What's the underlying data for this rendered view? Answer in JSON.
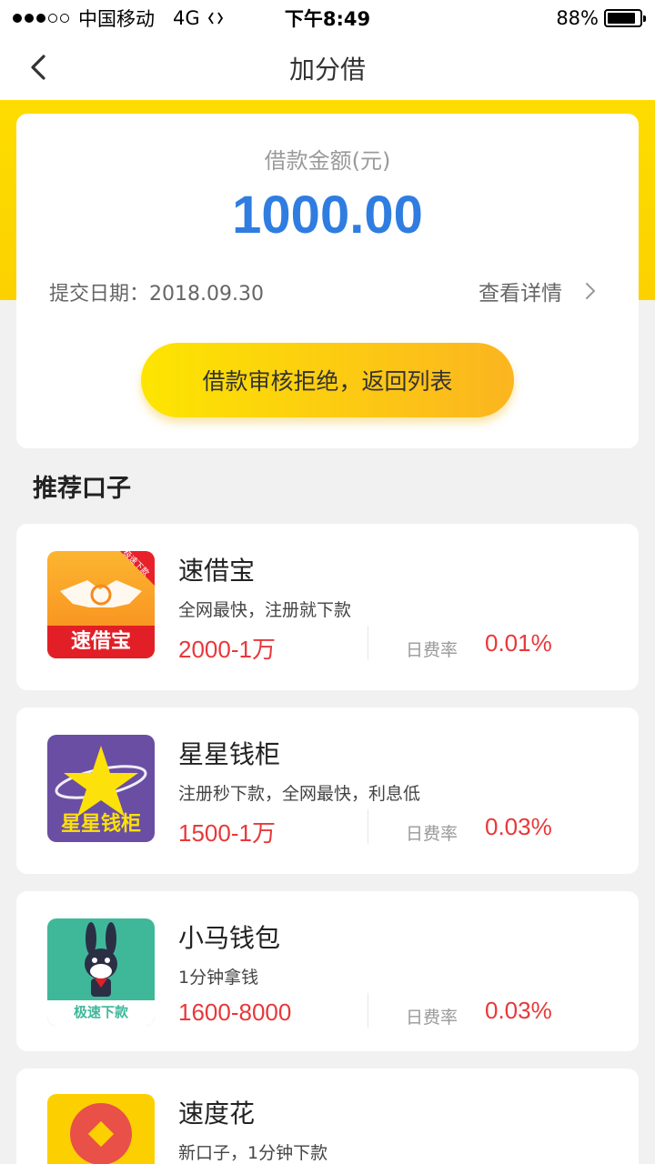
{
  "status_bar": {
    "carrier": "中国移动",
    "network": "4G",
    "time": "下午8:49",
    "battery_percent": "88%",
    "battery_level": 0.88
  },
  "nav": {
    "title": "加分借",
    "back_icon": "chevron-left-icon"
  },
  "loan": {
    "amount_label": "借款金额(元)",
    "amount": "1000.00",
    "submit_date": "提交日期：2018.09.30",
    "detail_link": "查看详情",
    "action_button": "借款审核拒绝，返回列表"
  },
  "recommend": {
    "section_title": "推荐口子",
    "rate_label": "日费率",
    "products": [
      {
        "name": "速借宝",
        "desc": "全网最快，注册就下款",
        "range": "2000-1万",
        "rate": "0.01%",
        "logo_text": "速借宝",
        "logo_badge": "极速下款",
        "logo_color": "#f89a1c"
      },
      {
        "name": "星星钱柜",
        "desc": "注册秒下款，全网最快，利息低",
        "range": "1500-1万",
        "rate": "0.03%",
        "logo_text": "星星钱柜",
        "logo_color": "#6a4ea3"
      },
      {
        "name": "小马钱包",
        "desc": "1分钟拿钱",
        "range": "1600-8000",
        "rate": "0.03%",
        "logo_text": "极速下款",
        "logo_color": "#3fb89a"
      },
      {
        "name": "速度花",
        "desc": "新口子，1分钟下款",
        "logo_color": "#fcd000"
      }
    ]
  },
  "colors": {
    "accent_blue": "#2f7de1",
    "accent_red": "#e8383a",
    "header_yellow": "#fedc00"
  }
}
